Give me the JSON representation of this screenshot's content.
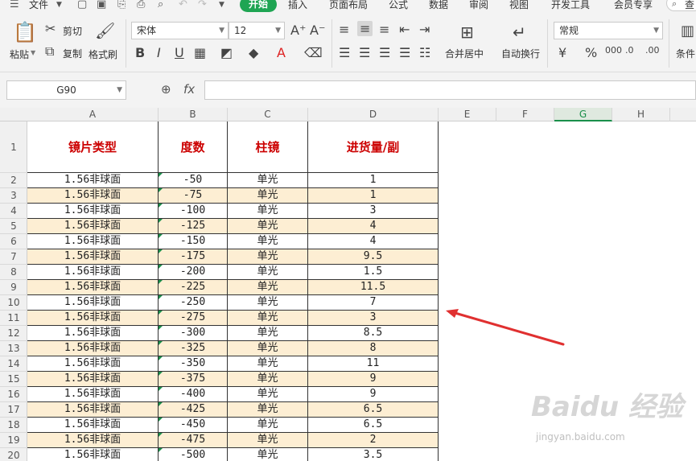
{
  "menu": {
    "file": "文件",
    "active_tab": "开始",
    "tabs": [
      "插入",
      "页面布局",
      "公式",
      "数据",
      "审阅",
      "视图",
      "开发工具",
      "会员专享"
    ],
    "search_partial": "查"
  },
  "ribbon": {
    "paste": "粘贴",
    "cut": "剪切",
    "copy": "复制",
    "format_painter": "格式刷",
    "font_name": "宋体",
    "font_size": "12",
    "merge_center": "合并居中",
    "wrap_text": "自动换行",
    "number_format": "常规",
    "conditional": "条件"
  },
  "formula_bar": {
    "name_box": "G90",
    "fx": "fx",
    "value": ""
  },
  "columns": [
    {
      "id": "A",
      "selected": false
    },
    {
      "id": "B",
      "selected": false
    },
    {
      "id": "C",
      "selected": false
    },
    {
      "id": "D",
      "selected": false
    },
    {
      "id": "E",
      "selected": false
    },
    {
      "id": "F",
      "selected": false
    },
    {
      "id": "G",
      "selected": true
    },
    {
      "id": "H",
      "selected": false
    }
  ],
  "table": {
    "headers": [
      "镜片类型",
      "度数",
      "柱镜",
      "进货量/副"
    ],
    "rows": [
      {
        "row": "2",
        "type": "1.56非球面",
        "deg": "-50",
        "cyl": "单光",
        "qty": "1"
      },
      {
        "row": "3",
        "type": "1.56非球面",
        "deg": "-75",
        "cyl": "单光",
        "qty": "1"
      },
      {
        "row": "4",
        "type": "1.56非球面",
        "deg": "-100",
        "cyl": "单光",
        "qty": "3"
      },
      {
        "row": "5",
        "type": "1.56非球面",
        "deg": "-125",
        "cyl": "单光",
        "qty": "4"
      },
      {
        "row": "6",
        "type": "1.56非球面",
        "deg": "-150",
        "cyl": "单光",
        "qty": "4"
      },
      {
        "row": "7",
        "type": "1.56非球面",
        "deg": "-175",
        "cyl": "单光",
        "qty": "9.5"
      },
      {
        "row": "8",
        "type": "1.56非球面",
        "deg": "-200",
        "cyl": "单光",
        "qty": "1.5"
      },
      {
        "row": "9",
        "type": "1.56非球面",
        "deg": "-225",
        "cyl": "单光",
        "qty": "11.5"
      },
      {
        "row": "10",
        "type": "1.56非球面",
        "deg": "-250",
        "cyl": "单光",
        "qty": "7"
      },
      {
        "row": "11",
        "type": "1.56非球面",
        "deg": "-275",
        "cyl": "单光",
        "qty": "3"
      },
      {
        "row": "12",
        "type": "1.56非球面",
        "deg": "-300",
        "cyl": "单光",
        "qty": "8.5"
      },
      {
        "row": "13",
        "type": "1.56非球面",
        "deg": "-325",
        "cyl": "单光",
        "qty": "8"
      },
      {
        "row": "14",
        "type": "1.56非球面",
        "deg": "-350",
        "cyl": "单光",
        "qty": "11"
      },
      {
        "row": "15",
        "type": "1.56非球面",
        "deg": "-375",
        "cyl": "单光",
        "qty": "9"
      },
      {
        "row": "16",
        "type": "1.56非球面",
        "deg": "-400",
        "cyl": "单光",
        "qty": "9"
      },
      {
        "row": "17",
        "type": "1.56非球面",
        "deg": "-425",
        "cyl": "单光",
        "qty": "6.5"
      },
      {
        "row": "18",
        "type": "1.56非球面",
        "deg": "-450",
        "cyl": "单光",
        "qty": "6.5"
      },
      {
        "row": "19",
        "type": "1.56非球面",
        "deg": "-475",
        "cyl": "单光",
        "qty": "2"
      },
      {
        "row": "20",
        "type": "1.56非球面",
        "deg": "-500",
        "cyl": "单光",
        "qty": "3.5"
      }
    ]
  },
  "colors": {
    "header_text": "#cc0000",
    "stripe": "#fdeed3",
    "accent": "#1fa553",
    "arrow": "#e03030"
  },
  "watermark": {
    "brand": "Baidu 经验",
    "url": "jingyan.baidu.com"
  }
}
